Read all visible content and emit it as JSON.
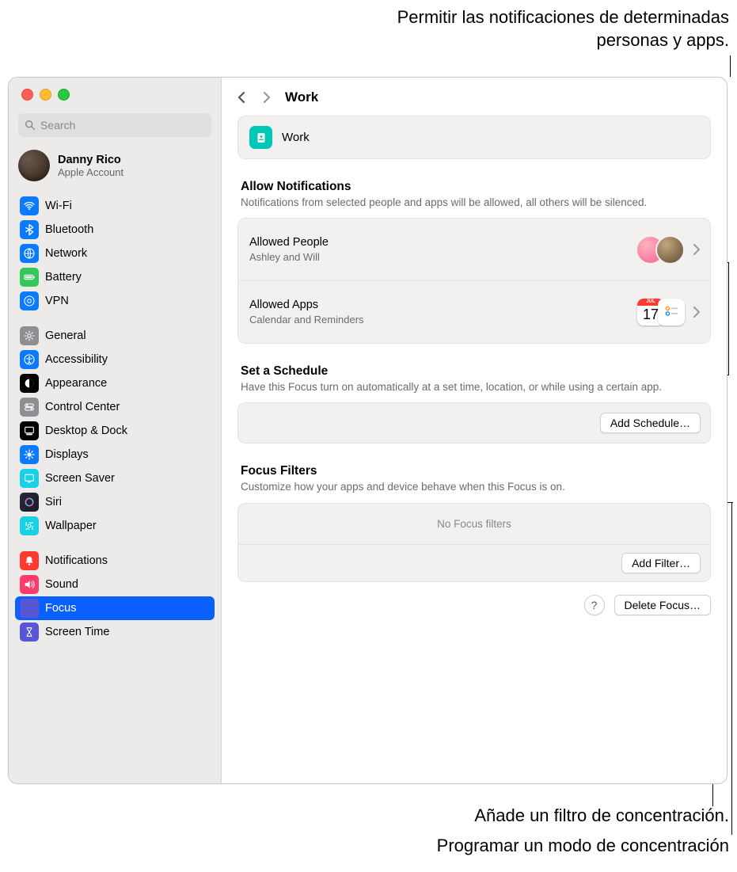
{
  "callouts": {
    "top": "Permitir las notificaciones de determinadas personas y apps.",
    "mid": "Añade un filtro de concentración.",
    "bottom": "Programar un modo de concentración"
  },
  "search": {
    "placeholder": "Search"
  },
  "account": {
    "name": "Danny Rico",
    "subtitle": "Apple Account"
  },
  "sidebar": {
    "group1": [
      {
        "label": "Wi-Fi"
      },
      {
        "label": "Bluetooth"
      },
      {
        "label": "Network"
      },
      {
        "label": "Battery"
      },
      {
        "label": "VPN"
      }
    ],
    "group2": [
      {
        "label": "General"
      },
      {
        "label": "Accessibility"
      },
      {
        "label": "Appearance"
      },
      {
        "label": "Control Center"
      },
      {
        "label": "Desktop & Dock"
      },
      {
        "label": "Displays"
      },
      {
        "label": "Screen Saver"
      },
      {
        "label": "Siri"
      },
      {
        "label": "Wallpaper"
      }
    ],
    "group3": [
      {
        "label": "Notifications"
      },
      {
        "label": "Sound"
      },
      {
        "label": "Focus"
      },
      {
        "label": "Screen Time"
      }
    ]
  },
  "header": {
    "title": "Work"
  },
  "focusCard": {
    "name": "Work"
  },
  "sections": {
    "allow": {
      "title": "Allow Notifications",
      "desc": "Notifications from selected people and apps will be allowed, all others will be silenced.",
      "people": {
        "title": "Allowed People",
        "sub": "Ashley and Will"
      },
      "apps": {
        "title": "Allowed Apps",
        "sub": "Calendar and Reminders",
        "cal_month": "JUL",
        "cal_day": "17"
      }
    },
    "schedule": {
      "title": "Set a Schedule",
      "desc": "Have this Focus turn on automatically at a set time, location, or while using a certain app.",
      "button": "Add Schedule…"
    },
    "filters": {
      "title": "Focus Filters",
      "desc": "Customize how your apps and device behave when this Focus is on.",
      "empty": "No Focus filters",
      "button": "Add Filter…"
    }
  },
  "footer": {
    "help": "?",
    "delete": "Delete Focus…"
  }
}
